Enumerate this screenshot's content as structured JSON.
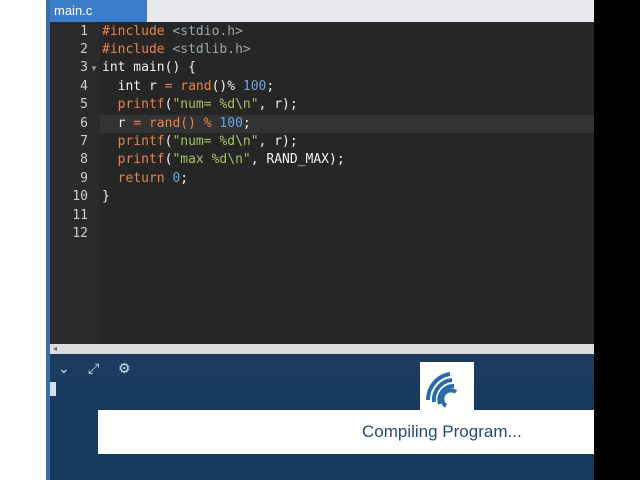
{
  "tab": {
    "label": "main.c"
  },
  "editor": {
    "current_line": 6,
    "lines": [
      {
        "n": "1"
      },
      {
        "n": "2"
      },
      {
        "n": "3"
      },
      {
        "n": "4"
      },
      {
        "n": "5"
      },
      {
        "n": "6"
      },
      {
        "n": "7"
      },
      {
        "n": "8"
      },
      {
        "n": "9"
      },
      {
        "n": "10"
      },
      {
        "n": "11"
      },
      {
        "n": "12"
      }
    ],
    "code": {
      "l1": [
        "#include",
        " ",
        "<stdio.h>"
      ],
      "l2": [
        "#include",
        " ",
        "<stdlib.h>"
      ],
      "l3": [
        "int main() {"
      ],
      "l4": [
        "  int r ",
        "= ",
        "rand",
        "()% ",
        "100",
        ";"
      ],
      "l5": [
        "  ",
        "printf",
        "(",
        "\"num= %d\\n\"",
        ", r);"
      ],
      "l6": [
        "  r ",
        "= ",
        "rand",
        "() % ",
        "100",
        ";"
      ],
      "l7": [
        "  ",
        "printf",
        "(",
        "\"num= %d\\n\"",
        ", r);"
      ],
      "l8": [
        "  ",
        "printf",
        "(",
        "\"max %d\\n\"",
        ", RAND_MAX);"
      ],
      "l9": [
        "  ",
        "return ",
        "0",
        ";"
      ],
      "l10": [
        "}"
      ],
      "l11": [
        ""
      ],
      "l12": [
        ""
      ]
    }
  },
  "bottom": {
    "message": "Compiling Program..."
  },
  "icons": {
    "collapse": "chevron-down-icon",
    "expand": "expand-icon",
    "run": "robot-icon"
  }
}
